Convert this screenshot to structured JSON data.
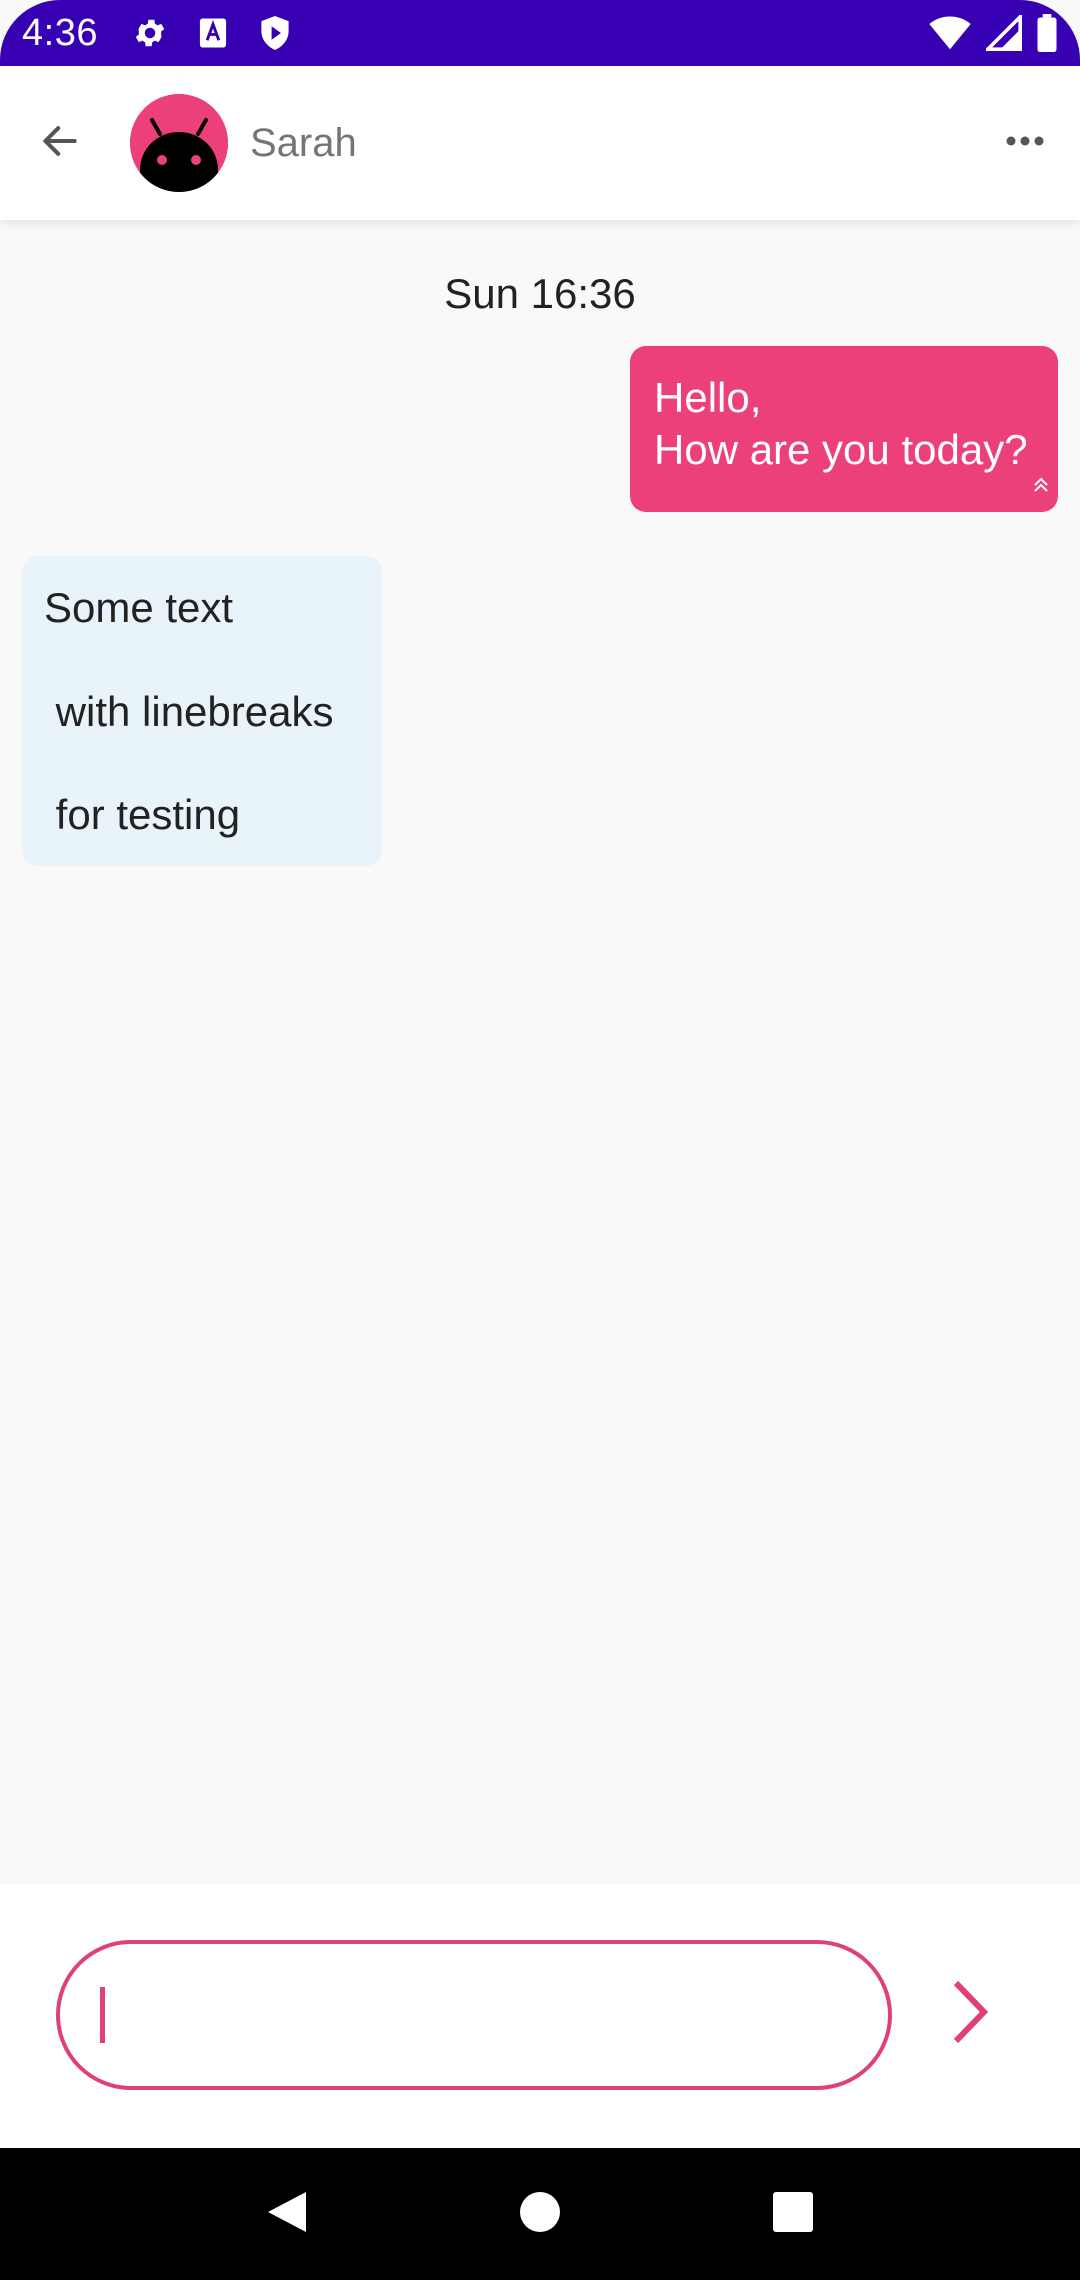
{
  "status_bar": {
    "time": "4:36",
    "left_icons": [
      "settings-icon",
      "text-a-icon",
      "shield-play-icon"
    ],
    "right_icons": [
      "wifi-icon",
      "signal-icon",
      "battery-icon"
    ],
    "background": "#3700b3"
  },
  "app_bar": {
    "contact_name": "Sarah",
    "avatar_color": "#ec407a",
    "icons": [
      "back-arrow-icon",
      "more-horizontal-icon"
    ]
  },
  "conversation": {
    "timestamp": "Sun 16:36",
    "outgoing": {
      "lines": [
        "Hello,",
        "How are you today?"
      ],
      "color": "#ec407a",
      "status_icon": "seen-double-chevron-icon"
    },
    "incoming": {
      "lines": [
        "Some text",
        " with linebreaks",
        " for testing"
      ],
      "color": "#e8f3fa"
    }
  },
  "composer": {
    "input_value": "",
    "accent": "#e0407a",
    "send_icon": "chevron-right-icon"
  },
  "nav_bar": {
    "icons": [
      "back-triangle-icon",
      "home-circle-icon",
      "recents-square-icon"
    ]
  }
}
